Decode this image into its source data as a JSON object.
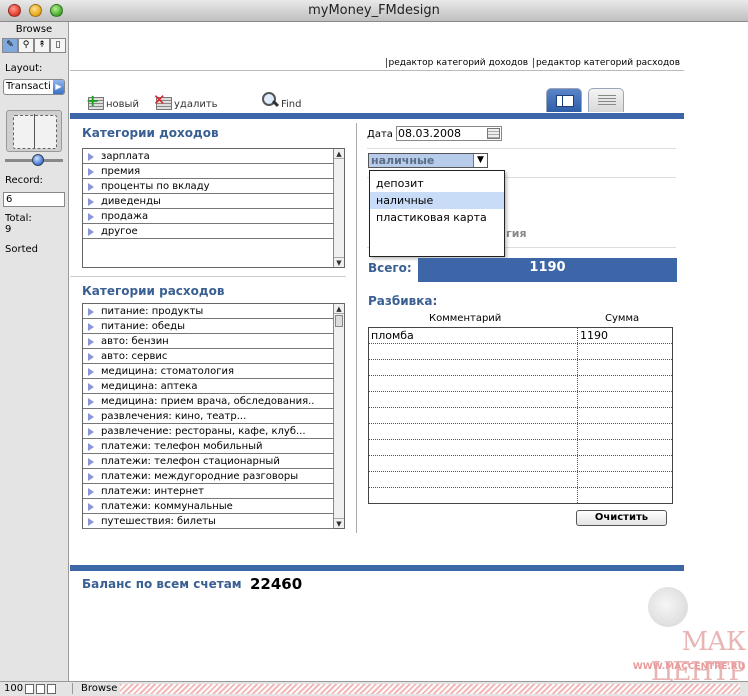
{
  "window": {
    "title": "myMoney_FMdesign"
  },
  "status_area": {
    "mode_label": "Browse",
    "mode_buttons": [
      "✎",
      "⚲",
      "↟",
      "▯"
    ],
    "layout_label": "Layout:",
    "layout_value": "Transacti",
    "record_label": "Record:",
    "record_value": "6",
    "total_label": "Total:",
    "total_value": "9",
    "sorted_label": "Sorted"
  },
  "bottom_bar": {
    "zoom": "100",
    "mode": "Browse"
  },
  "header": {
    "nav_income_editor": "редактор категорий доходов",
    "nav_expense_editor": "редактор категорий расходов"
  },
  "toolbar": {
    "new_label": "новый",
    "delete_label": "удалить",
    "find_label": "Find"
  },
  "income_categories": {
    "title": "Категории доходов",
    "items": [
      "зарплата",
      "премия",
      "проценты по вкладу",
      "диведенды",
      "продажа",
      "другое"
    ]
  },
  "expense_categories": {
    "title": "Категории расходов",
    "items": [
      "питание: продукты",
      "питание: обеды",
      "авто: бензин",
      "авто: сервис",
      "медицина: стоматология",
      "медицина: аптека",
      "медицина: прием врача, обследования..",
      "развлечения: кино, театр...",
      "развлечение: рестораны, кафе, клуб...",
      "платежи: телефон мобильный",
      "платежи: телефон стационарный",
      "платежи: междугородние разговоры",
      "платежи: интернет",
      "платежи: коммунальные",
      "путешествия: билеты"
    ]
  },
  "transaction": {
    "date_label": "Дата",
    "date_value": "08.03.2008",
    "account_value": "наличные",
    "account_options": [
      "депозит",
      "наличные",
      "пластиковая карта"
    ],
    "account_selected_index": 1,
    "category_text_partial": "гия",
    "total_label": "Всего:",
    "total_value": "1190"
  },
  "breakdown": {
    "title": "Разбивка:",
    "col_comment": "Комментарий",
    "col_amount": "Сумма",
    "rows": [
      {
        "comment": "пломба",
        "amount": "1190"
      },
      {
        "comment": "",
        "amount": ""
      },
      {
        "comment": "",
        "amount": ""
      },
      {
        "comment": "",
        "amount": ""
      },
      {
        "comment": "",
        "amount": ""
      },
      {
        "comment": "",
        "amount": ""
      },
      {
        "comment": "",
        "amount": ""
      },
      {
        "comment": "",
        "amount": ""
      },
      {
        "comment": "",
        "amount": ""
      },
      {
        "comment": "",
        "amount": ""
      }
    ],
    "clear_button": "Очистить"
  },
  "balance": {
    "label": "Баланс по всем счетам",
    "value": "22460"
  },
  "watermark": {
    "brand": "МАК ЦЕНТР",
    "site": "WWW.MACCENTRE.RU"
  },
  "colors": {
    "accent_blue": "#3c66a8",
    "title_blue": "#3a5f93",
    "selection_blue": "#c8dcf7"
  }
}
